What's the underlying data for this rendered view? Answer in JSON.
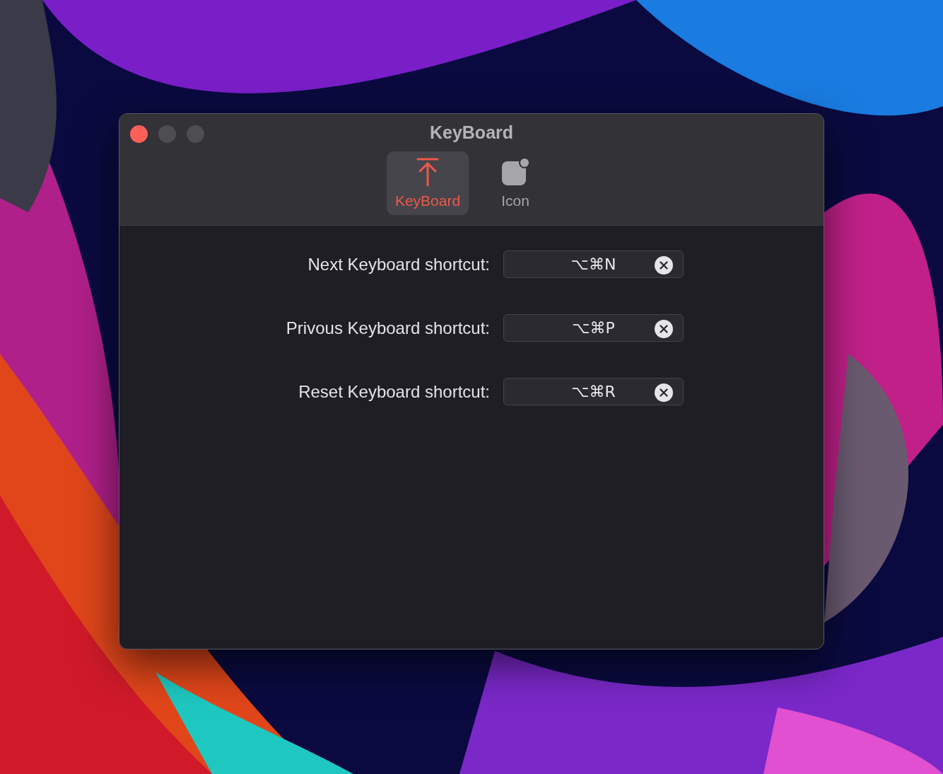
{
  "window": {
    "title": "KeyBoard"
  },
  "tabs": [
    {
      "label": "KeyBoard",
      "kind": "keyboard",
      "selected": true
    },
    {
      "label": "Icon",
      "kind": "icon",
      "selected": false
    }
  ],
  "shortcuts": [
    {
      "label": "Next Keyboard shortcut:",
      "value": "⌥⌘N"
    },
    {
      "label": "Privous Keyboard shortcut:",
      "value": "⌥⌘P"
    },
    {
      "label": "Reset Keyboard shortcut:",
      "value": "⌥⌘R"
    }
  ]
}
